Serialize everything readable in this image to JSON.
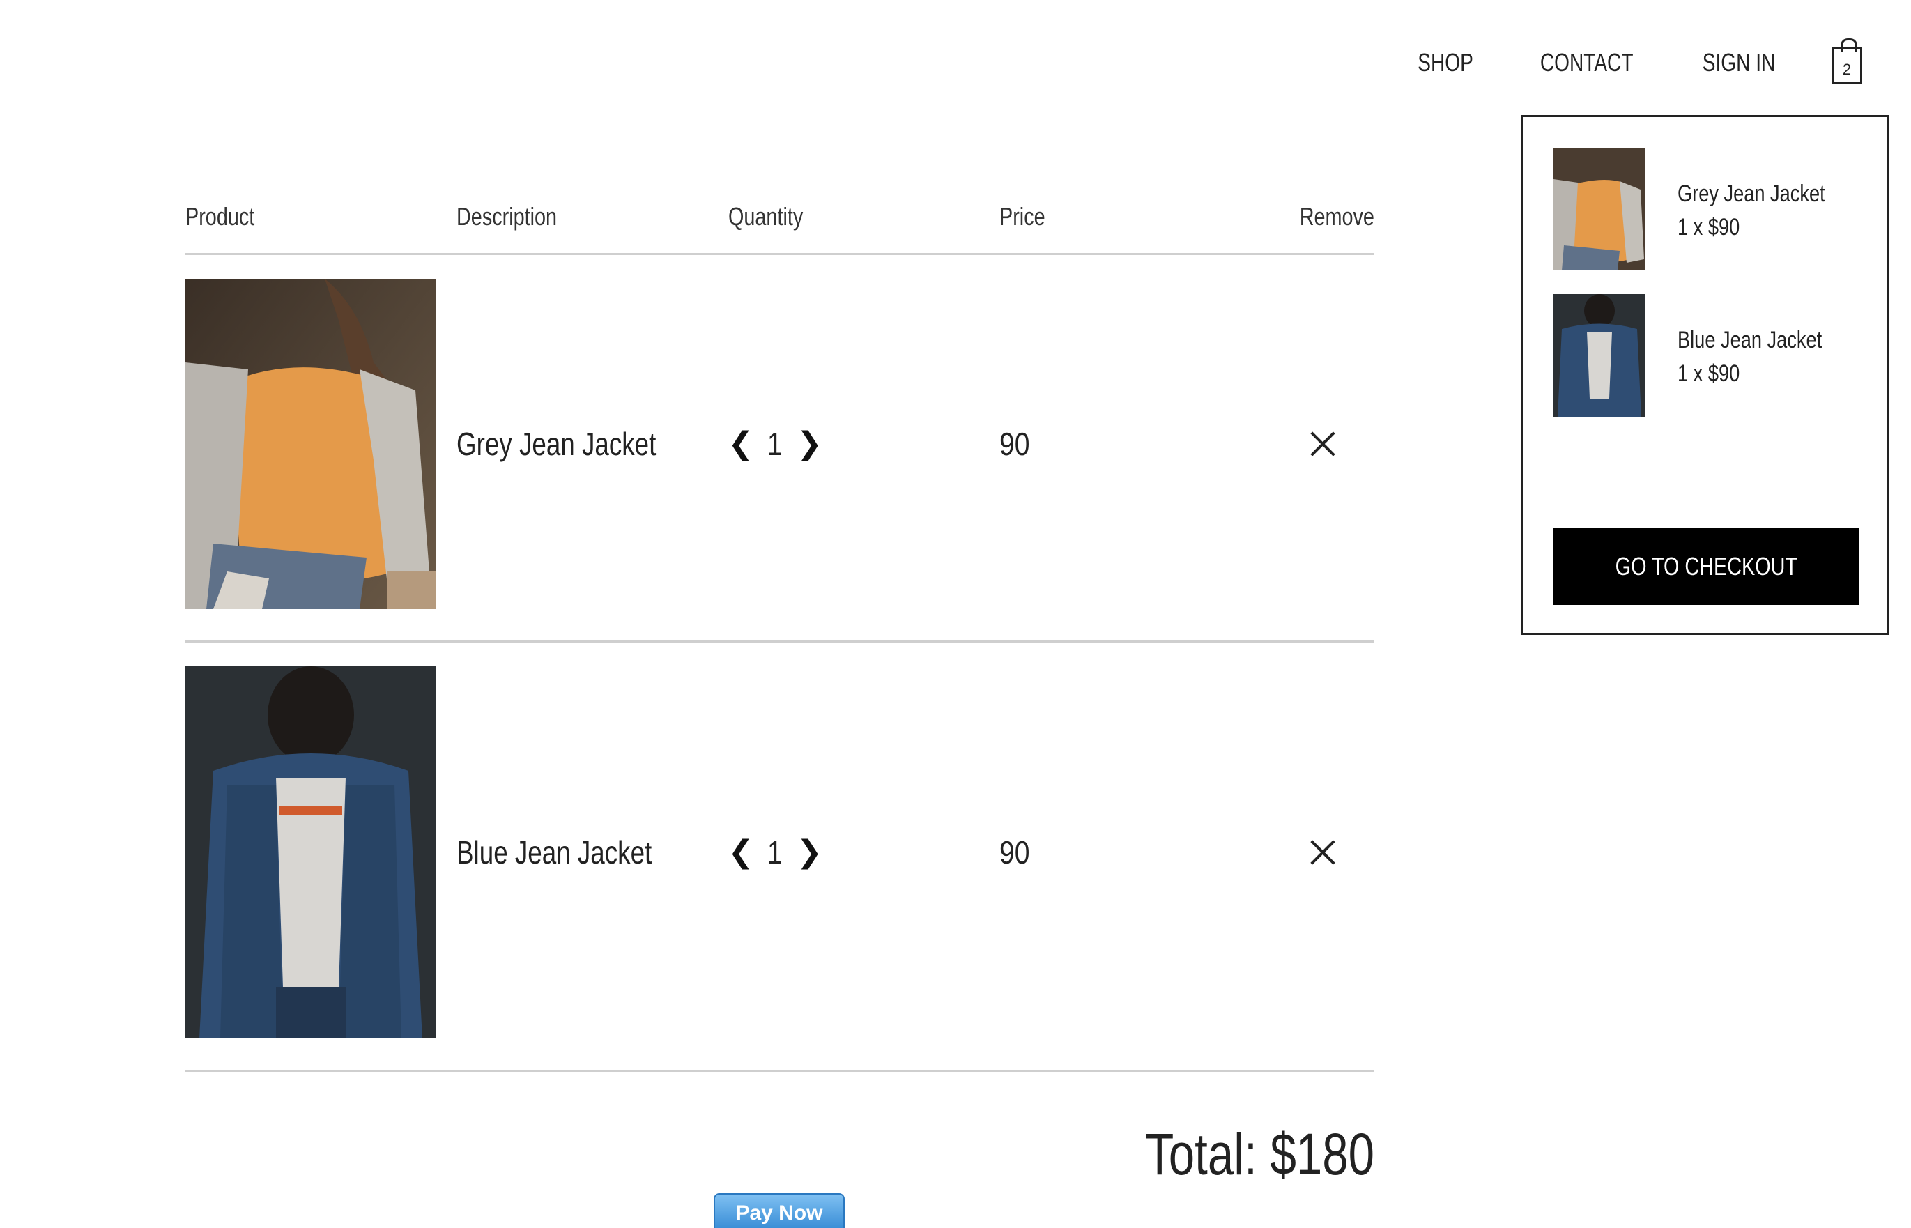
{
  "nav": {
    "shop": "SHOP",
    "contact": "CONTACT",
    "sign_in": "SIGN IN",
    "cart_count": "2"
  },
  "table": {
    "headers": {
      "product": "Product",
      "description": "Description",
      "quantity": "Quantity",
      "price": "Price",
      "remove": "Remove"
    },
    "rows": [
      {
        "description": "Grey Jean Jacket",
        "quantity": "1",
        "price": "90"
      },
      {
        "description": "Blue Jean Jacket",
        "quantity": "1",
        "price": "90"
      }
    ]
  },
  "total": "Total: $180",
  "pay_button": "Pay Now",
  "dropdown": {
    "items": [
      {
        "name": "Grey Jean Jacket",
        "qty_price": "1 x $90"
      },
      {
        "name": "Blue Jean Jacket",
        "qty_price": "1 x $90"
      }
    ],
    "checkout_label": "GO TO CHECKOUT"
  },
  "icons": {
    "decrease": "chevron-left-icon",
    "increase": "chevron-right-icon",
    "remove": "close-icon",
    "cart": "shopping-bag-icon"
  },
  "colors": {
    "checkout_bg": "#000000",
    "pay_button": "#2f86d2",
    "divider": "#cfcfcf"
  }
}
